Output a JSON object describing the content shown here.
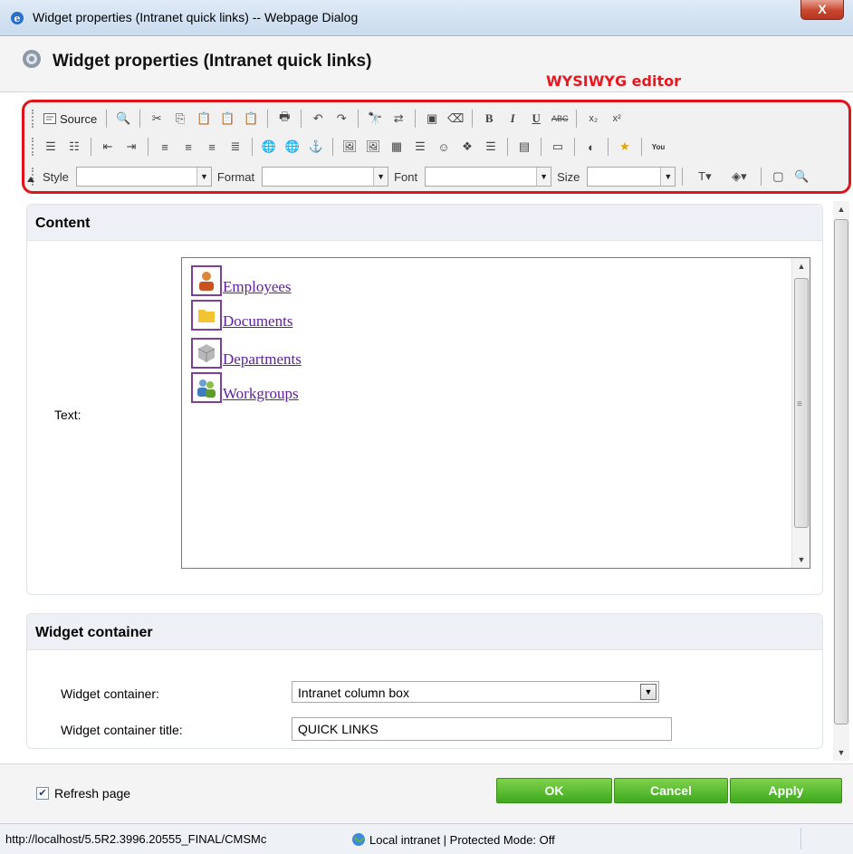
{
  "window": {
    "title": "Widget properties (Intranet quick links) -- Webpage Dialog",
    "close_label": "X"
  },
  "header": {
    "title": "Widget properties (Intranet quick links)",
    "annotation": "WYSIWYG editor",
    "annotation_color": "#e8171f"
  },
  "toolbar": {
    "source_label": "Source",
    "style_label": "Style",
    "format_label": "Format",
    "font_label": "Font",
    "size_label": "Size",
    "bold": "B",
    "italic": "I",
    "underline": "U",
    "strike": "ABC",
    "subscript": "x₂",
    "superscript": "x²",
    "youtube": "You"
  },
  "content": {
    "section_title": "Content",
    "text_label": "Text:",
    "links": [
      {
        "label": "Employees",
        "icon": "employee-icon"
      },
      {
        "label": "Documents",
        "icon": "folder-icon"
      },
      {
        "label": "Departments",
        "icon": "cube-icon"
      },
      {
        "label": "Workgroups",
        "icon": "group-icon"
      }
    ],
    "link_color": "#5f1d9d"
  },
  "container": {
    "section_title": "Widget container",
    "container_label": "Widget container:",
    "container_value": "Intranet column box",
    "title_label": "Widget container title:",
    "title_value": "QUICK LINKS"
  },
  "footer": {
    "refresh_label": "Refresh page",
    "refresh_checked": true,
    "ok_label": "OK",
    "cancel_label": "Cancel",
    "apply_label": "Apply",
    "button_color": "#3ea91d"
  },
  "statusbar": {
    "url": "http://localhost/5.5R2.3996.20555_FINAL/CMSMc",
    "zone": "Local intranet | Protected Mode: Off"
  }
}
